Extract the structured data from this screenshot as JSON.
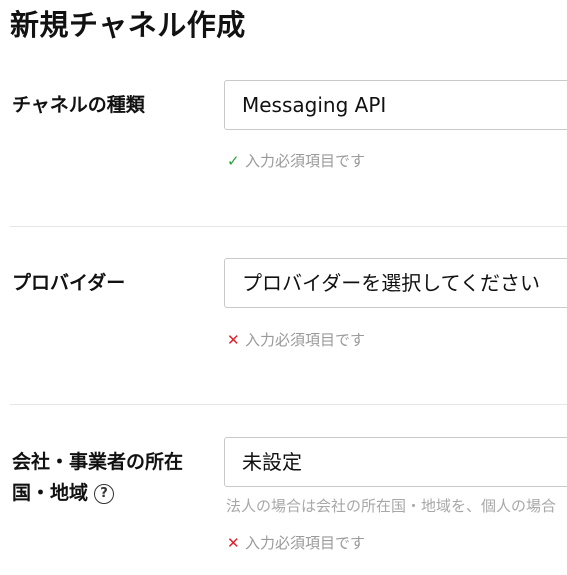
{
  "page_title": "新規チャネル作成",
  "fields": [
    {
      "label": "チャネルの種類",
      "value": "Messaging API",
      "status_text": "入力必須項目です",
      "status_mark": "✓"
    },
    {
      "label": "プロバイダー",
      "value": "プロバイダーを選択してください",
      "status_text": "入力必須項目です",
      "status_mark": "✕"
    },
    {
      "label_line1": "会社・事業者の所在",
      "label_line2": "国・地域",
      "help_icon": "?",
      "value": "未設定",
      "hint": "法人の場合は会社の所在国・地域を、個人の場合",
      "status_text": "入力必須項目です",
      "status_mark": "✕"
    }
  ]
}
